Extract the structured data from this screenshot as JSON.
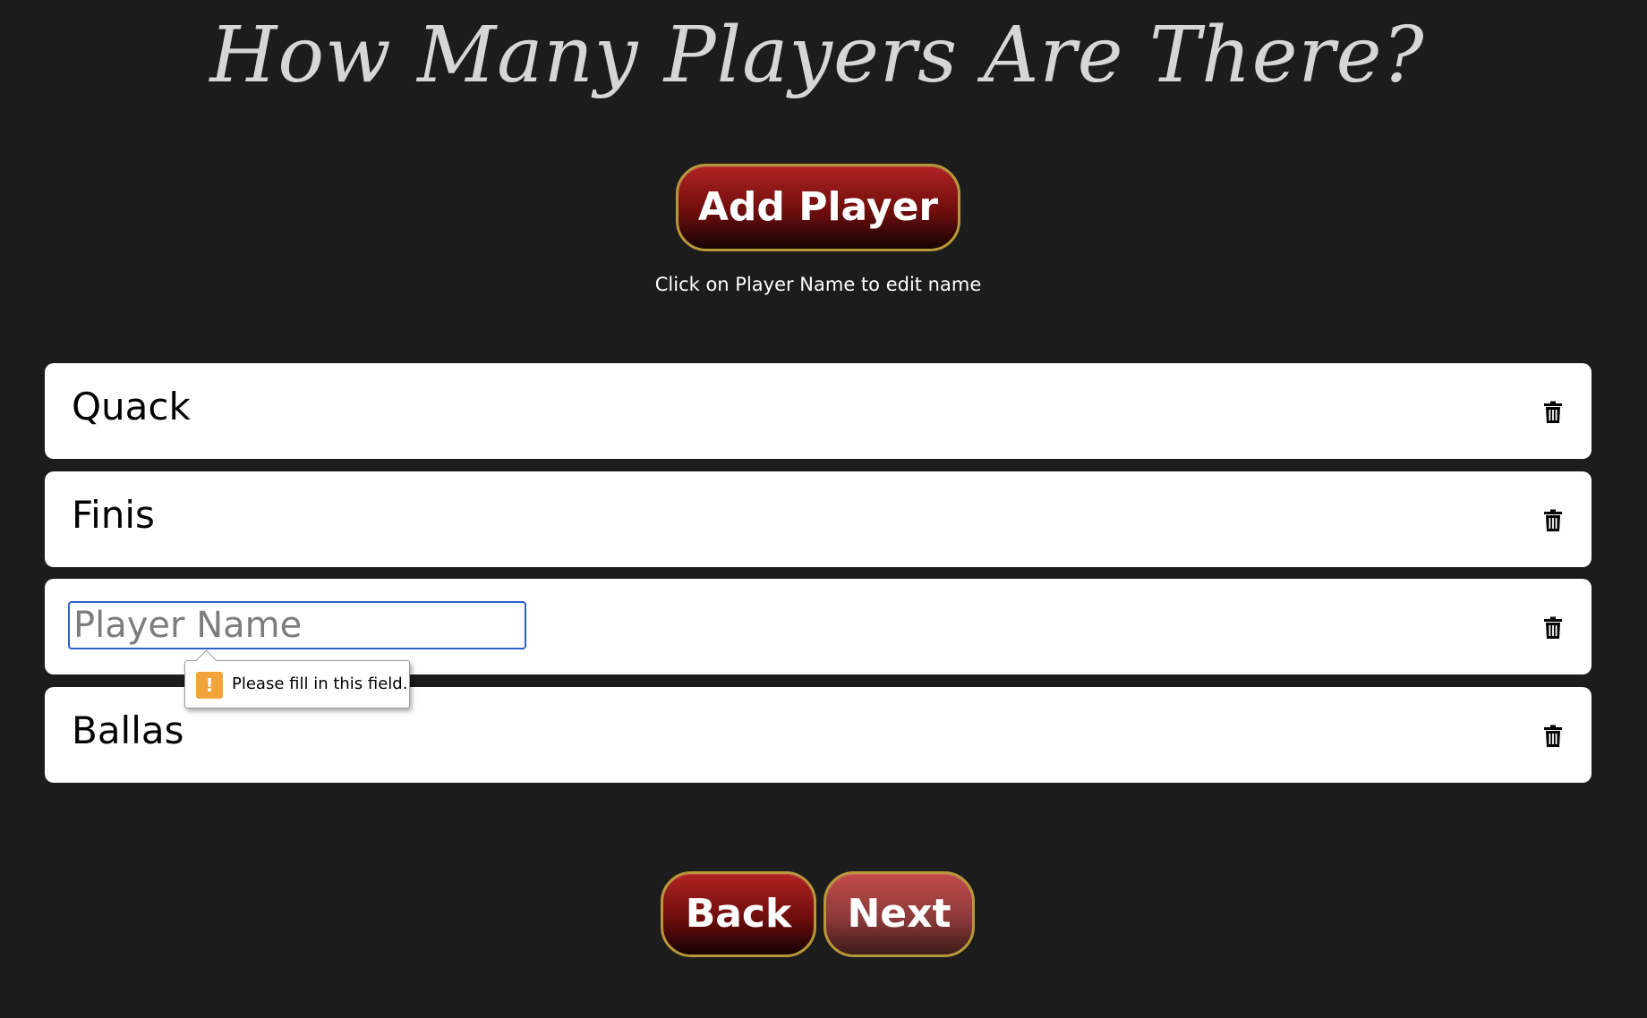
{
  "page": {
    "title": "How Many Players Are There?",
    "hint": "Click on Player Name to edit name"
  },
  "buttons": {
    "add_player": "Add Player",
    "back": "Back",
    "next": "Next"
  },
  "players": [
    {
      "name": "Quack",
      "editing": false
    },
    {
      "name": "Finis",
      "editing": false
    },
    {
      "name": "",
      "editing": true,
      "placeholder": "Player Name"
    },
    {
      "name": "Ballas",
      "editing": false
    }
  ],
  "validation": {
    "message": "Please fill in this field.",
    "icon": "warning-icon",
    "icon_glyph": "!"
  },
  "icons": {
    "delete": "trash-icon"
  },
  "colors": {
    "background": "#1c1c1c",
    "title": "#d6d6d6",
    "button_red": "#b02222",
    "button_border": "#b8973a",
    "input_focus": "#2b62c8",
    "warning": "#f2a33a"
  }
}
